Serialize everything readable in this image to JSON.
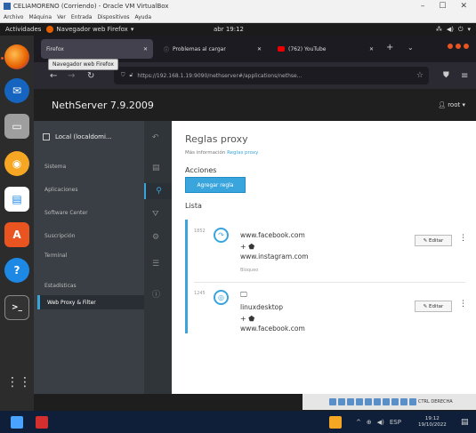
{
  "vbox": {
    "title": "CELIAMORENO (Corriendo) - Oracle VM VirtualBox",
    "menu": [
      "Archivo",
      "Máquina",
      "Ver",
      "Entrada",
      "Dispositivos",
      "Ayuda"
    ],
    "status_text": "CTRL DERECHA"
  },
  "ubuntu": {
    "activities": "Actividades",
    "app_name": "Navegador web Firefox",
    "clock": "abr 19:12",
    "dock_apps": [
      "firefox-icon",
      "thunderbird-icon",
      "files-icon",
      "rhythmbox-icon",
      "libreoffice-icon",
      "software-icon",
      "help-icon",
      "terminal-icon"
    ]
  },
  "firefox": {
    "tooltip": "Navegador web Firefox",
    "tabs": [
      {
        "label": "Firefox",
        "active": true
      },
      {
        "label": "Problemas al cargar",
        "active": false
      },
      {
        "label": "(762) YouTube",
        "active": false
      }
    ],
    "url": "https://192.168.1.19:9090/nethserver#/applications/nethse..."
  },
  "nethserver": {
    "brand": "NethServer 7.9.2009",
    "user": "root",
    "node": "Local (localdomi...",
    "nav": [
      "Sistema",
      "Aplicaciones",
      "Software Center",
      "Suscripción",
      "Terminal",
      "Estadísticas",
      "Web Proxy & Filter"
    ],
    "active_nav": "Web Proxy & Filter",
    "title": "Reglas proxy",
    "more_info_prefix": "Más información",
    "more_info_link": "Reglas proxy",
    "actions_label": "Acciones",
    "add_rule_label": "Agregar regla",
    "list_label": "Lista",
    "rules": [
      {
        "priority": "1852",
        "source": "www.facebook.com",
        "destination": "www.instagram.com",
        "meta": "Bloqueo",
        "icon": "share-icon",
        "edit_label": "Editar"
      },
      {
        "priority": "1245",
        "source": "linuxdesktop",
        "destination": "www.facebook.com",
        "meta": "",
        "icon": "target-icon",
        "edit_label": "Editar"
      }
    ]
  },
  "windows": {
    "time": "19:12",
    "date": "19/10/2022",
    "lang": "ESP"
  },
  "colors": {
    "accent": "#39a5dc",
    "ubuntu_orange": "#e95420",
    "sidebar": "#393f44",
    "header": "#1f1f1f"
  }
}
